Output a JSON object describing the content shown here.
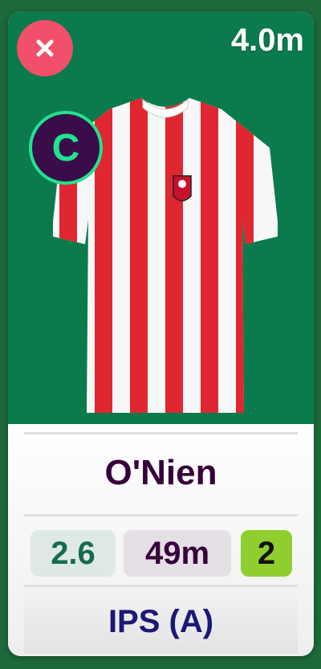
{
  "player": {
    "price": "4.0m",
    "captain_badge": "C",
    "name": "O'Nien",
    "points": "2.6",
    "selected_by": "49m",
    "bonus": "2",
    "fixture": "IPS (A)"
  },
  "icons": {
    "close": "close-icon",
    "shirt": "shirt-icon",
    "captain": "captain-badge"
  },
  "colors": {
    "pitch": "#0b7a4c",
    "close": "#f24f6b",
    "captain_bg": "#3a0d4a",
    "captain_fg": "#22e38f",
    "name": "#37003c",
    "fixture": "#1c1877",
    "bonus": "#8fce2e"
  }
}
